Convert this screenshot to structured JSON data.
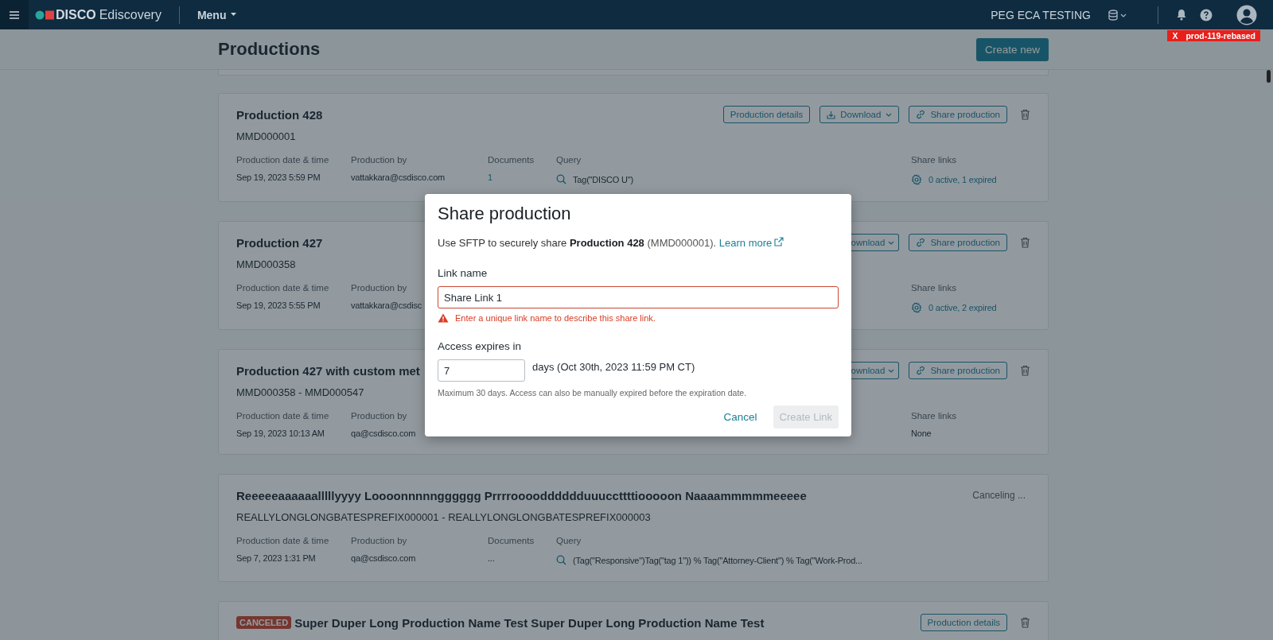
{
  "topbar": {
    "brand": "DISCO",
    "product": "Ediscovery",
    "menu": "Menu",
    "workspace": "PEG ECA TESTING"
  },
  "env_tag": {
    "close": "X",
    "label": "prod-119-rebased"
  },
  "page": {
    "title": "Productions",
    "create_button": "Create new"
  },
  "productions": [
    {
      "title": "Production 428",
      "bates": "MMD000001",
      "actions": [
        {
          "kind": "details",
          "label": "Production details"
        },
        {
          "kind": "download",
          "label": "Download"
        },
        {
          "kind": "share",
          "label": "Share production"
        },
        {
          "kind": "delete"
        }
      ],
      "columns": [
        {
          "kind": "date",
          "label": "Production date & time",
          "value": "Sep 19, 2023 5:59 PM"
        },
        {
          "kind": "by",
          "label": "Production by",
          "value": "vattakkara@csdisco.com"
        },
        {
          "kind": "documents",
          "label": "Documents",
          "value": "1"
        },
        {
          "kind": "query",
          "label": "Query",
          "value": "Tag(\"DISCO U\")"
        },
        {
          "kind": "share_links",
          "label": "Share links",
          "value": "0 active, 1 expired"
        }
      ]
    },
    {
      "title": "Production 427",
      "bates": "MMD000358",
      "actions": [
        {
          "kind": "download_clipped",
          "label": "ownload"
        },
        {
          "kind": "share",
          "label": "Share production"
        },
        {
          "kind": "delete"
        }
      ],
      "columns": [
        {
          "kind": "date",
          "label": "Production date & time",
          "value": "Sep 19, 2023 5:55 PM"
        },
        {
          "kind": "by",
          "label": "Production by",
          "value": "vattakkara@csdisc"
        },
        {
          "kind": "share_links",
          "label": "Share links",
          "value": "0 active, 2 expired"
        }
      ]
    },
    {
      "title": "Production 427 with custom met",
      "bates": "MMD000358 - MMD000547",
      "actions": [
        {
          "kind": "download_clipped",
          "label": "ownload"
        },
        {
          "kind": "share",
          "label": "Share production"
        },
        {
          "kind": "delete"
        }
      ],
      "columns": [
        {
          "kind": "date",
          "label": "Production date & time",
          "value": "Sep 19, 2023 10:13 AM"
        },
        {
          "kind": "by",
          "label": "Production by",
          "value": "qa@csdisco.com"
        },
        {
          "kind": "share_links_plain",
          "label": "Share links",
          "value": "None"
        }
      ]
    },
    {
      "title": "Reeeeeaaaaaalllllyyyy Loooonnnnngggggg Prrrroooodddddduuuccttttiooooon Naaaammmmmeeeee",
      "bates": "REALLYLONGLONGBATESPREFIX000001 - REALLYLONGLONGBATESPREFIX000003",
      "status": "Canceling ...",
      "columns": [
        {
          "kind": "date",
          "label": "Production date & time",
          "value": "Sep 7, 2023 1:31 PM"
        },
        {
          "kind": "by",
          "label": "Production by",
          "value": "qa@csdisco.com"
        },
        {
          "kind": "documents_plain",
          "label": "Documents",
          "value": "..."
        },
        {
          "kind": "query",
          "label": "Query",
          "value": "(Tag(\"Responsive\")Tag(\"tag 1\")) % Tag(\"Attorney-Client\") % Tag(\"Work-Prod..."
        }
      ]
    },
    {
      "title": "Super Duper Long Production Name Test Super Duper Long Production Name Test",
      "badge": "CANCELED",
      "actions": [
        {
          "kind": "details",
          "label": "Production details"
        },
        {
          "kind": "delete"
        }
      ]
    }
  ],
  "dialog": {
    "title": "Share production",
    "intro_before": "Use SFTP to securely share ",
    "intro_bold": "Production 428",
    "intro_after": " (MMD000001).",
    "learn_more": "Learn more",
    "link_label": "Link name",
    "link_value": "Share Link 1",
    "link_error": "Enter a unique link name to describe this share link.",
    "expires_label": "Access expires in",
    "expires_value": "7",
    "expires_suffix": "days (Oct 30th, 2023 11:59 PM CT)",
    "hint": "Maximum 30 days. Access can also be manually expired before the expiration date.",
    "cancel": "Cancel",
    "create": "Create Link",
    "create_disabled": true
  }
}
